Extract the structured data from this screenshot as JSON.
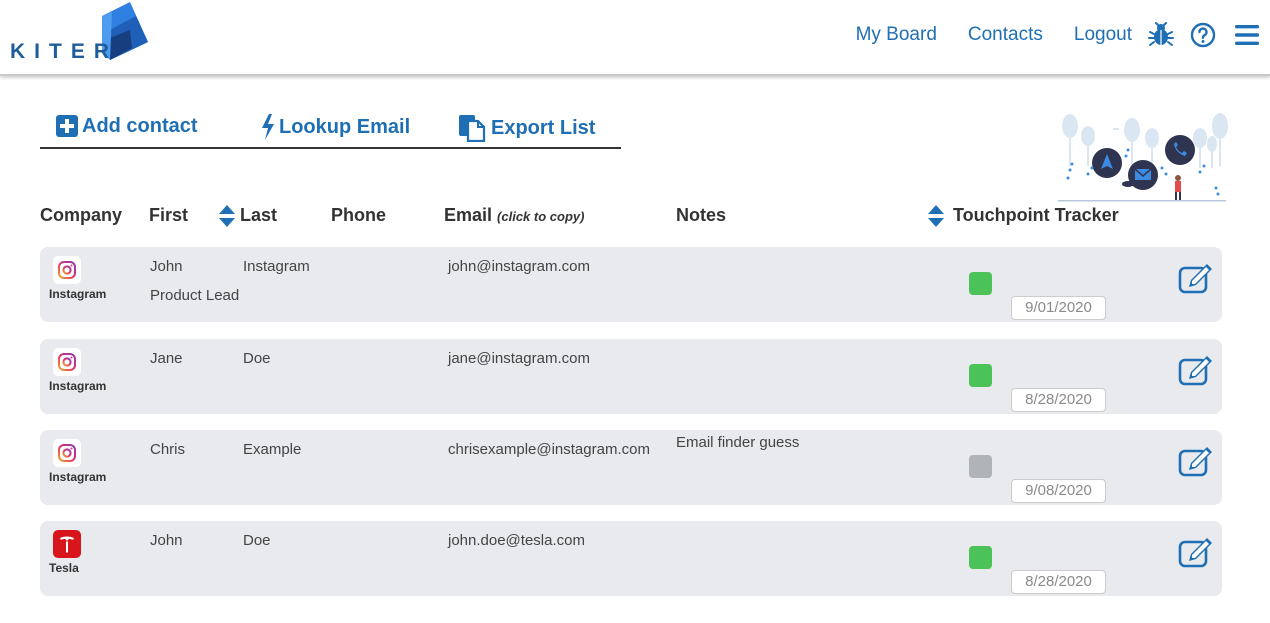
{
  "brand": {
    "name": "KITER"
  },
  "nav": {
    "links": [
      "My Board",
      "Contacts",
      "Logout"
    ],
    "icons": [
      "bug-icon",
      "help-icon",
      "hamburger-menu-icon"
    ]
  },
  "actions": {
    "add": "Add contact",
    "lookup": "Lookup Email",
    "export": "Export List"
  },
  "columns": {
    "company": "Company",
    "first": "First",
    "last": "Last",
    "phone": "Phone",
    "email": "Email",
    "email_hint": "(click to copy)",
    "notes": "Notes",
    "tracker": "Touchpoint Tracker"
  },
  "colors": {
    "accent": "#1f6fb5",
    "status_done": "#4cc359",
    "status_pending": "#b0b4b8",
    "row_bg": "#e8eaed"
  },
  "contacts": [
    {
      "company": "Instagram",
      "logo": "instagram-icon",
      "first": "John",
      "last": "Instagram",
      "title": "Product Lead",
      "phone": "",
      "email": "john@instagram.com",
      "notes": "",
      "status": "done",
      "date": "9/01/2020"
    },
    {
      "company": "Instagram",
      "logo": "instagram-icon",
      "first": "Jane",
      "last": "Doe",
      "title": "",
      "phone": "",
      "email": "jane@instagram.com",
      "notes": "",
      "status": "done",
      "date": "8/28/2020"
    },
    {
      "company": "Instagram",
      "logo": "instagram-icon",
      "first": "Chris",
      "last": "Example",
      "title": "",
      "phone": "",
      "email": "chrisexample@instagram.com",
      "notes": "Email finder guess",
      "status": "pending",
      "date": "9/08/2020"
    },
    {
      "company": "Tesla",
      "logo": "tesla-icon",
      "first": "John",
      "last": "Doe",
      "title": "",
      "phone": "",
      "email": "john.doe@tesla.com",
      "notes": "",
      "status": "done",
      "date": "8/28/2020"
    }
  ]
}
